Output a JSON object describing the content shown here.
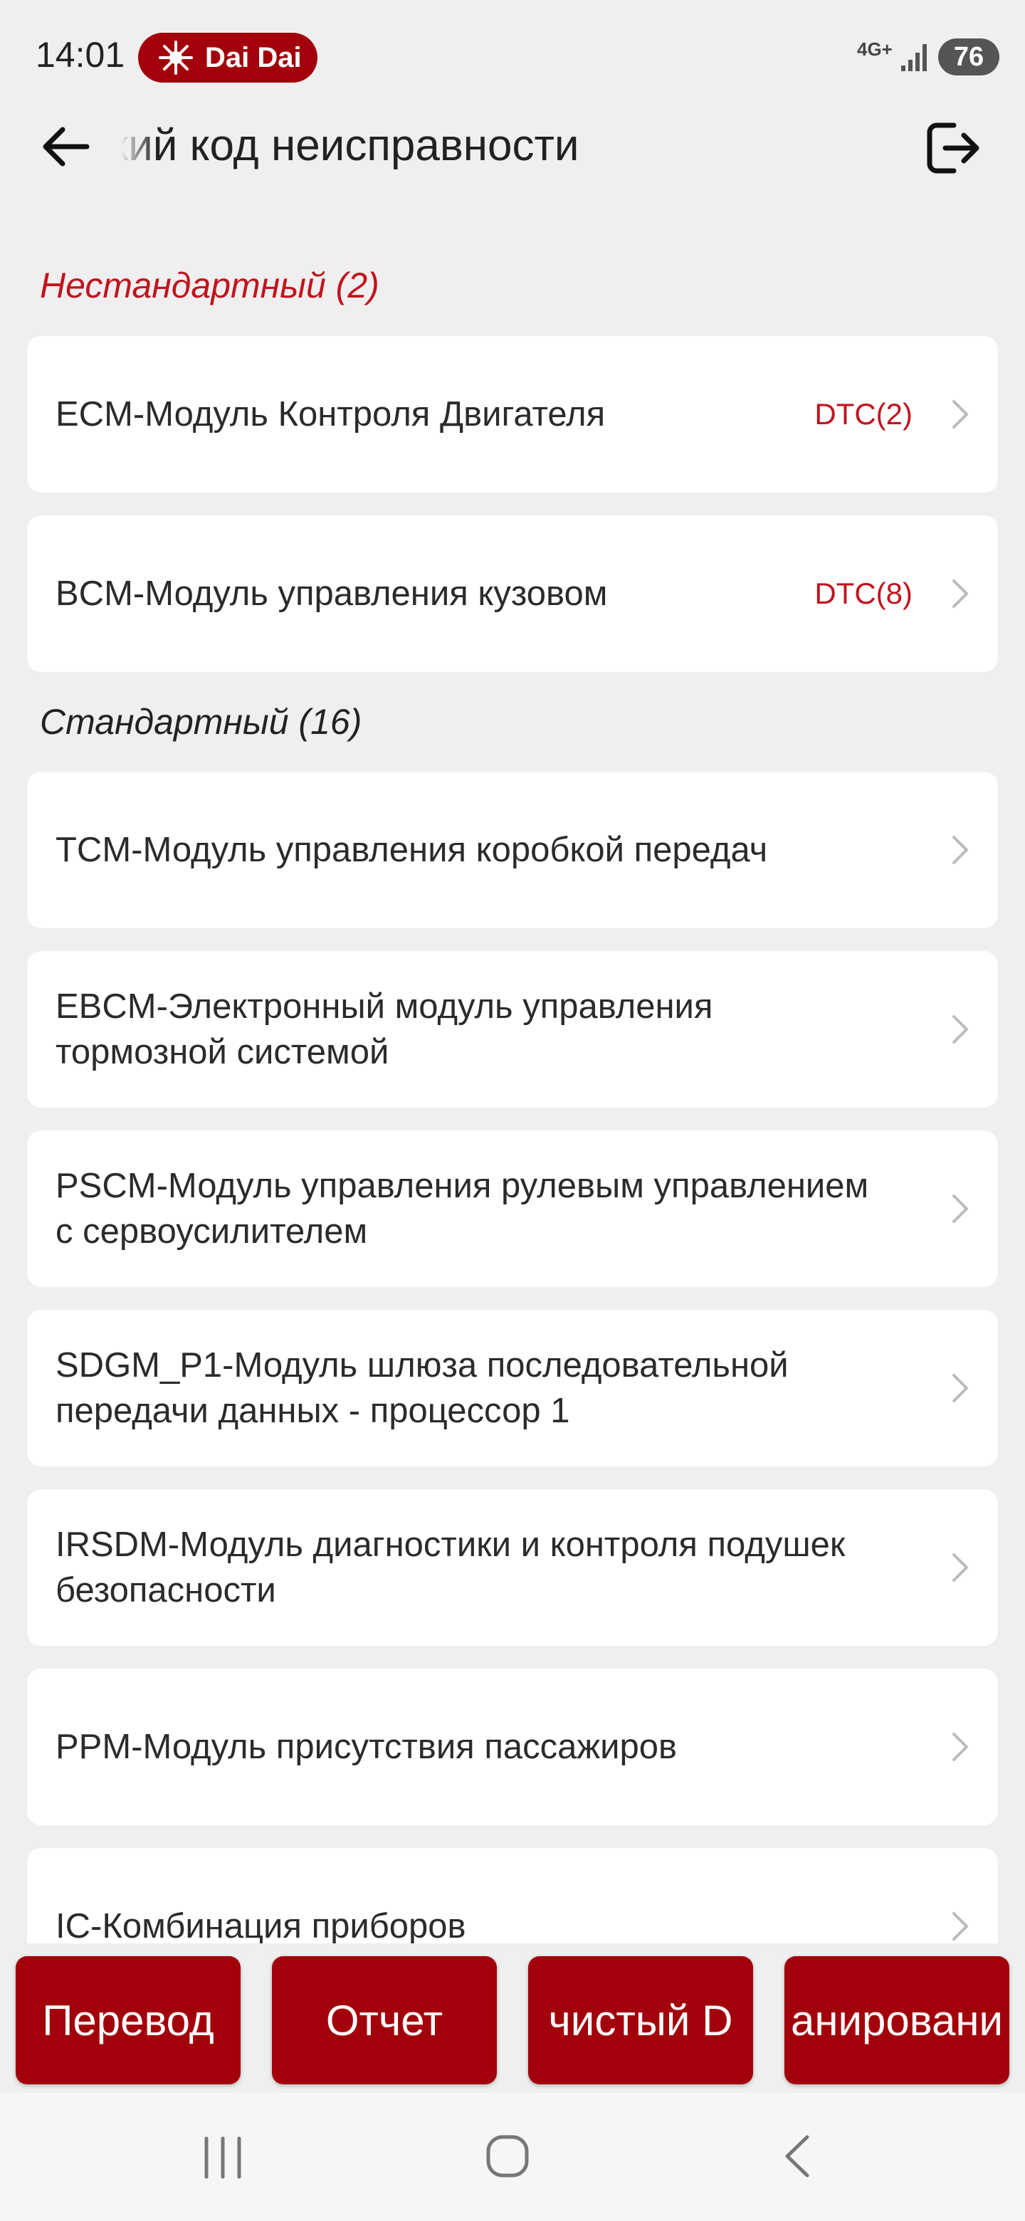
{
  "status_bar": {
    "time": "14:01",
    "notification": "Dai Dai",
    "network": "4G+",
    "battery": "76"
  },
  "header": {
    "title": "ский код неисправности",
    "back_icon": "arrow-left-icon",
    "exit_icon": "logout-icon"
  },
  "sections": {
    "nonstandard": {
      "label": "Нестандартный  (2)"
    },
    "standard": {
      "label": "Стандартный  (16)"
    }
  },
  "nonstandard_items": [
    {
      "label": "ECM-Модуль Контроля Двигателя",
      "dtc": "DTC(2)"
    },
    {
      "label": "BCM-Модуль управления кузовом",
      "dtc": "DTC(8)"
    }
  ],
  "standard_items": [
    {
      "label": "TCM-Модуль управления коробкой передач"
    },
    {
      "label": "EBCM-Электронный модуль управления тормозной системой"
    },
    {
      "label": "PSCM-Модуль управления рулевым управлением с сервоусилителем"
    },
    {
      "label": "SDGM_P1-Модуль шлюза последовательной передачи данных - процессор 1"
    },
    {
      "label": "IRSDM-Модуль диагностики и контроля подушек безопасности"
    },
    {
      "label": "PPM-Модуль присутствия пассажиров"
    },
    {
      "label": "IC-Комбинация приборов"
    }
  ],
  "buttons": {
    "translate": "Перевод",
    "report": "Отчет",
    "clear": "чистый D",
    "scan": "анировани"
  },
  "colors": {
    "accent": "#a2000a",
    "dtc": "#c0141e",
    "background": "#efefef"
  }
}
